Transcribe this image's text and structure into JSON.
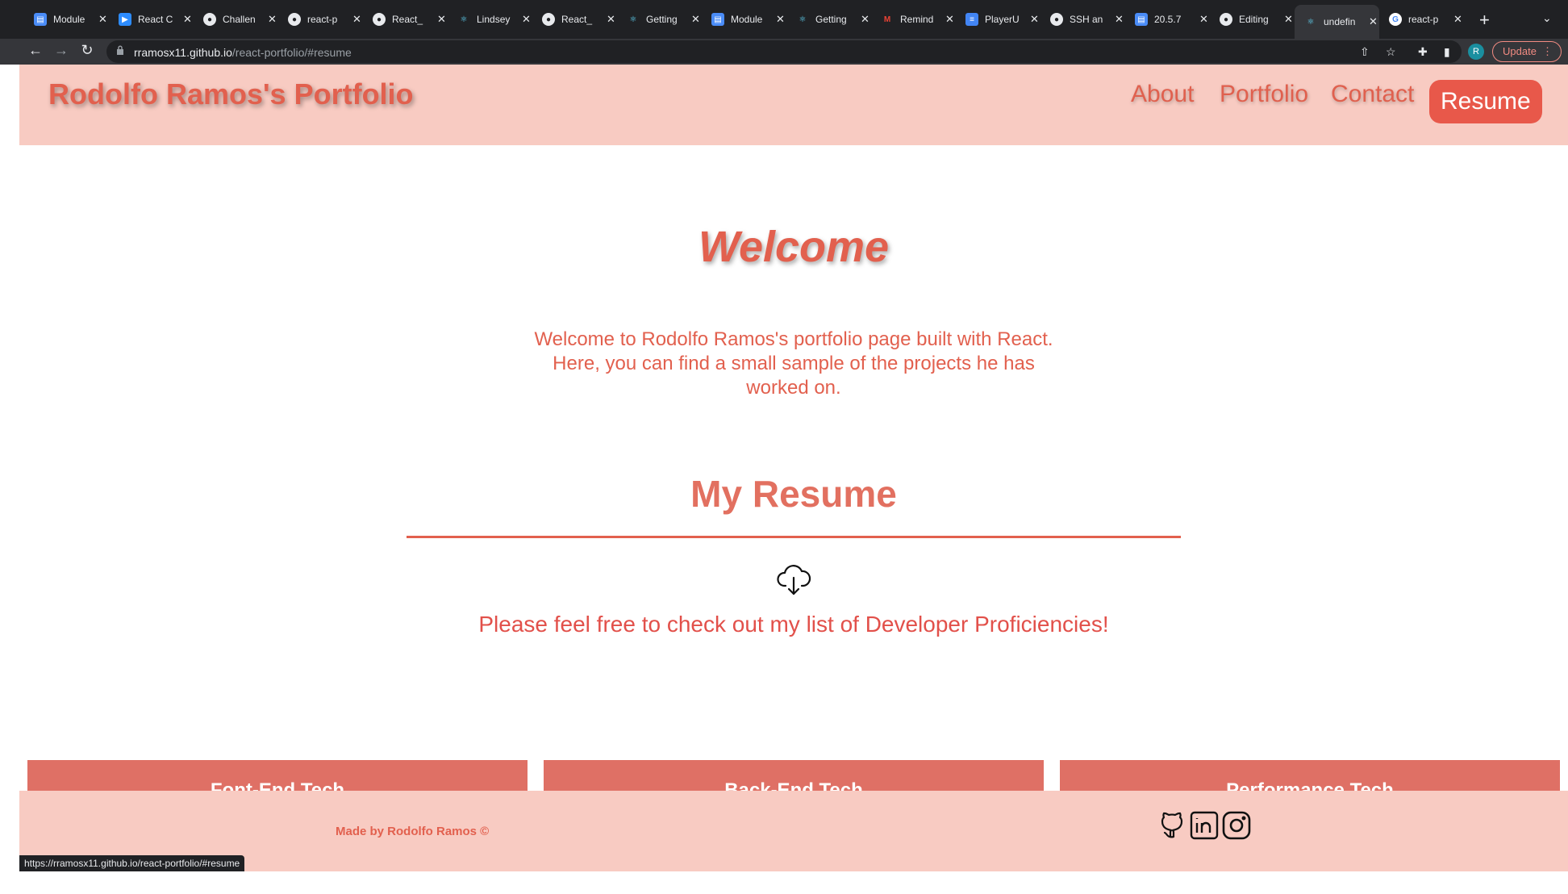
{
  "browser": {
    "tabs": [
      {
        "title": "Module",
        "icon": "doc-icon",
        "color": "#4a8cf7"
      },
      {
        "title": "React C",
        "icon": "zoom-icon",
        "color": "#2d8cff"
      },
      {
        "title": "Challen",
        "icon": "github-icon",
        "color": "#202124"
      },
      {
        "title": "react-p",
        "icon": "github-icon",
        "color": "#202124"
      },
      {
        "title": "React_",
        "icon": "github-icon",
        "color": "#202124"
      },
      {
        "title": "Lindsey",
        "icon": "react-icon",
        "color": "#202124"
      },
      {
        "title": "React_",
        "icon": "github-icon",
        "color": "#202124"
      },
      {
        "title": "Getting",
        "icon": "react-icon",
        "color": "#202124"
      },
      {
        "title": "Module",
        "icon": "doc-icon",
        "color": "#4a8cf7"
      },
      {
        "title": "Getting",
        "icon": "react-icon",
        "color": "#202124"
      },
      {
        "title": "Remind",
        "icon": "gmail-icon",
        "color": "#202124"
      },
      {
        "title": "PlayerU",
        "icon": "docs-icon",
        "color": "#4285f4"
      },
      {
        "title": "SSH an",
        "icon": "github-icon",
        "color": "#202124"
      },
      {
        "title": "20.5.7",
        "icon": "doc-icon",
        "color": "#4a8cf7"
      },
      {
        "title": "Editing",
        "icon": "github-icon",
        "color": "#202124"
      },
      {
        "title": "undefin",
        "icon": "react-icon",
        "color": "#202124",
        "active": true
      },
      {
        "title": "react-p",
        "icon": "google-icon",
        "color": "#202124"
      }
    ],
    "url_host": "rramosx11.github.io",
    "url_path": "/react-portfolio/#resume",
    "avatar_letter": "R",
    "update_label": "Update",
    "status_url": "https://rramosx11.github.io/react-portfolio/#resume"
  },
  "header": {
    "brand": "Rodolfo Ramos's Portfolio",
    "nav": [
      "About",
      "Portfolio",
      "Contact",
      "Resume"
    ]
  },
  "main": {
    "welcome_title": "Welcome",
    "intro": "Welcome to Rodolfo Ramos's portfolio page built with React. Here, you can find a small sample of the projects he has worked on.",
    "resume_title": "My Resume",
    "proficiencies_text": "Please feel free to check out my list of Developer Proficiencies!",
    "cards": [
      "Font-End Tech",
      "Back-End Tech",
      "Performance Tech"
    ]
  },
  "footer": {
    "made_by": "Made by Rodolfo Ramos ©",
    "social": [
      "github-icon",
      "linkedin-icon",
      "instagram-icon"
    ]
  },
  "colors": {
    "accent": "#e2604e",
    "header_bg": "#f8cbc2",
    "card_bg": "#df7065"
  }
}
